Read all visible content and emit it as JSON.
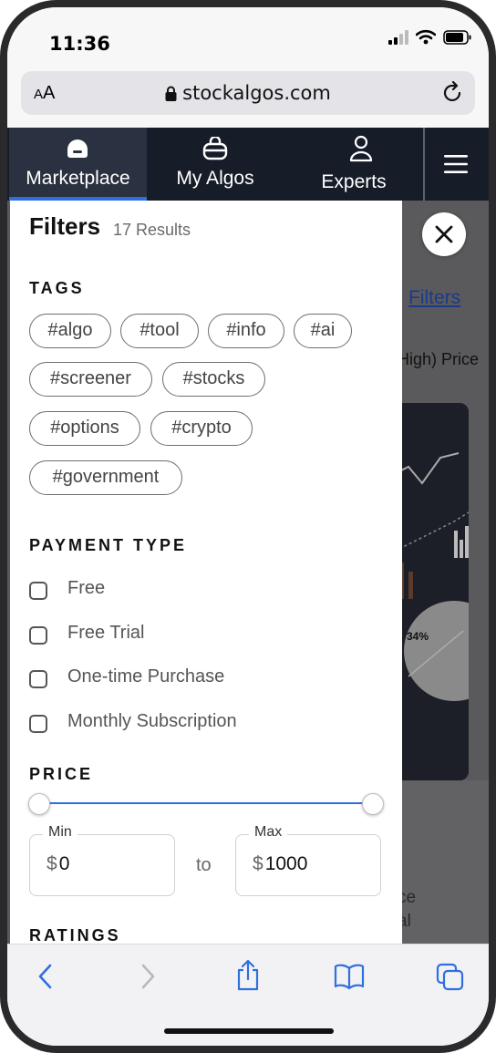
{
  "status_bar": {
    "time": "11:36"
  },
  "browser": {
    "text_size_label": "AA",
    "url": "stockalgos.com"
  },
  "nav": {
    "items": [
      {
        "label": "Marketplace",
        "active": true
      },
      {
        "label": "My Algos",
        "active": false
      },
      {
        "label": "Experts",
        "active": false
      }
    ]
  },
  "background_page": {
    "filters_link": "Filters",
    "sort_text": "High)  Price",
    "card_label": "34%",
    "text_line1": "ce",
    "text_line2": "al"
  },
  "filters": {
    "title": "Filters",
    "results": "17 Results",
    "tags_heading": "TAGS",
    "tags": [
      "#algo",
      "#tool",
      "#info",
      "#ai",
      "#screener",
      "#stocks",
      "#options",
      "#crypto",
      "#government"
    ],
    "payment_heading": "PAYMENT TYPE",
    "payment_options": [
      {
        "label": "Free",
        "checked": false
      },
      {
        "label": "Free Trial",
        "checked": false
      },
      {
        "label": "One-time Purchase",
        "checked": false
      },
      {
        "label": "Monthly Subscription",
        "checked": false
      }
    ],
    "price_heading": "PRICE",
    "price": {
      "min_label": "Min",
      "max_label": "Max",
      "currency": "$",
      "min_value": "0",
      "max_value": "1000",
      "to_label": "to"
    },
    "ratings_heading": "RATINGS"
  },
  "colors": {
    "accent": "#2f6fe0",
    "nav_bg": "#161c28"
  }
}
